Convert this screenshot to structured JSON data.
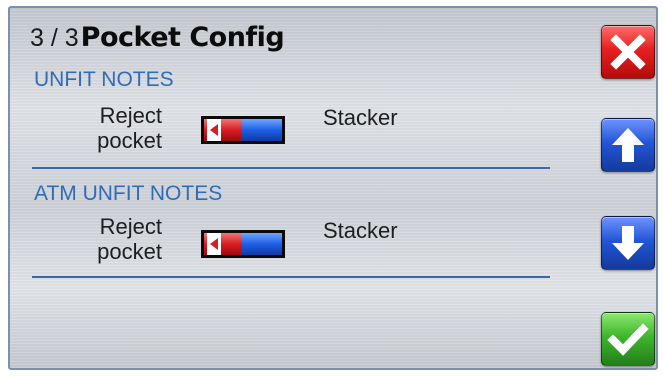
{
  "header": {
    "page_indicator": "3 / 3",
    "title": "Pocket Config"
  },
  "sections": [
    {
      "heading": "UNFIT NOTES",
      "left_label_line1": "Reject",
      "left_label_line2": "pocket",
      "right_label": "Stacker",
      "toggle_position": "left"
    },
    {
      "heading": "ATM UNFIT NOTES",
      "left_label_line1": "Reject",
      "left_label_line2": "pocket",
      "right_label": "Stacker",
      "toggle_position": "left"
    }
  ],
  "side_buttons": [
    {
      "action": "close",
      "icon": "close-x-icon",
      "color": "#e52020"
    },
    {
      "action": "scroll-up",
      "icon": "arrow-up-icon",
      "color": "#2356d6"
    },
    {
      "action": "scroll-down",
      "icon": "arrow-down-icon",
      "color": "#2356d6"
    },
    {
      "action": "confirm",
      "icon": "checkmark-icon",
      "color": "#3fb52c"
    }
  ],
  "colors": {
    "section_heading": "#2f6db6",
    "divider": "#3a67a8",
    "toggle_left": "#d81d22",
    "toggle_right": "#1f5fe6"
  }
}
